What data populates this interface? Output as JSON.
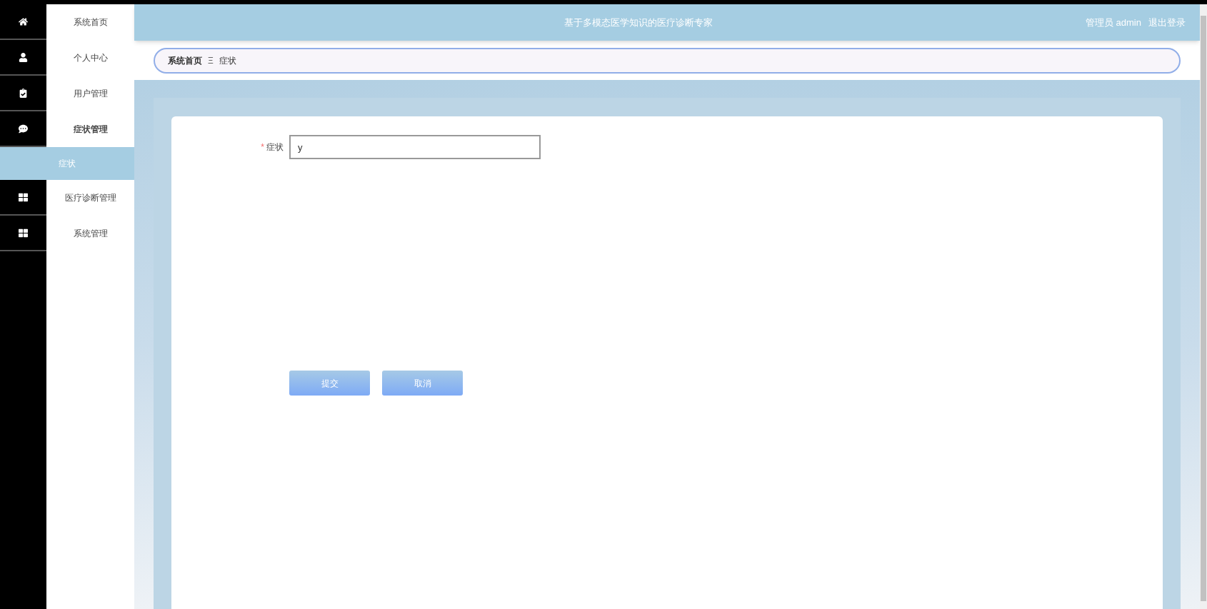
{
  "header": {
    "title": "基于多模态医学知识的医疗诊断专家",
    "user": "管理员 admin",
    "logout": "退出登录"
  },
  "sidebar": {
    "items": [
      {
        "label": "系统首页",
        "selected": false,
        "expanded": false
      },
      {
        "label": "个人中心",
        "selected": false,
        "expanded": false
      },
      {
        "label": "用户管理",
        "selected": false,
        "expanded": false
      },
      {
        "label": "症状管理",
        "selected": false,
        "expanded": true,
        "children": [
          {
            "label": "症状",
            "selected": true
          }
        ]
      },
      {
        "label": "医疗诊断管理",
        "selected": false,
        "expanded": false
      },
      {
        "label": "系统管理",
        "selected": false,
        "expanded": false
      }
    ]
  },
  "breadcrumb": {
    "items": [
      "系统首页",
      "症状"
    ],
    "separator": "Ξ"
  },
  "form": {
    "fields": [
      {
        "label": "症状",
        "required": true,
        "required_mark": "*",
        "value": "y"
      }
    ],
    "buttons": [
      "提交",
      "取消"
    ]
  }
}
